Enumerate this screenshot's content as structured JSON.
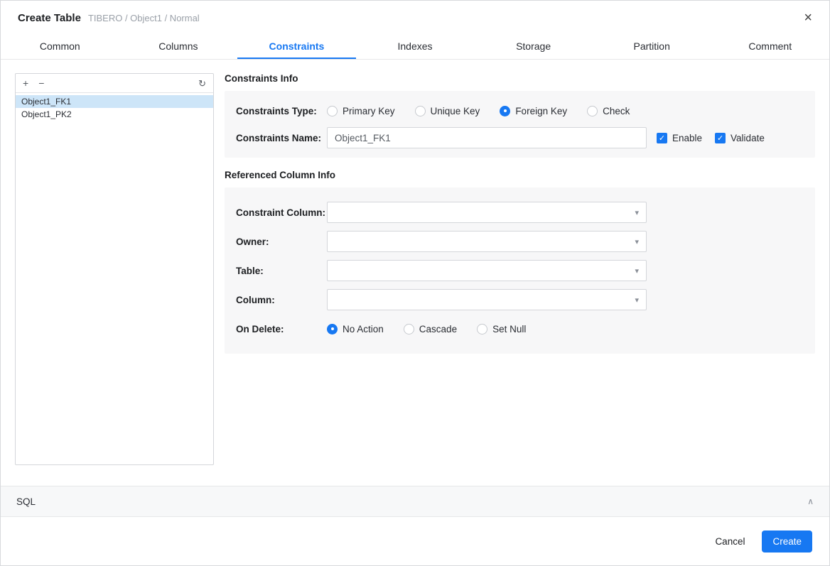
{
  "dialog": {
    "title": "Create Table",
    "subtitle": "TIBERO / Object1 / Normal"
  },
  "icons": {
    "close": "×",
    "add": "+",
    "remove": "−",
    "refresh": "↻",
    "caret_down": "▾",
    "chevron_up": "∧",
    "check": "✓"
  },
  "tabs": [
    {
      "label": "Common",
      "active": false
    },
    {
      "label": "Columns",
      "active": false
    },
    {
      "label": "Constraints",
      "active": true
    },
    {
      "label": "Indexes",
      "active": false
    },
    {
      "label": "Storage",
      "active": false
    },
    {
      "label": "Partition",
      "active": false
    },
    {
      "label": "Comment",
      "active": false
    }
  ],
  "constraint_list": {
    "items": [
      {
        "name": "Object1_FK1",
        "selected": true
      },
      {
        "name": "Object1_PK2",
        "selected": false
      }
    ]
  },
  "constraints_info": {
    "heading": "Constraints Info",
    "type_label": "Constraints Type:",
    "type_options": [
      {
        "label": "Primary Key",
        "checked": false
      },
      {
        "label": "Unique Key",
        "checked": false
      },
      {
        "label": "Foreign Key",
        "checked": true
      },
      {
        "label": "Check",
        "checked": false
      }
    ],
    "name_label": "Constraints Name:",
    "name_value": "Object1_FK1",
    "enable_label": "Enable",
    "enable_checked": true,
    "validate_label": "Validate",
    "validate_checked": true
  },
  "referenced_column_info": {
    "heading": "Referenced Column Info",
    "fields": [
      {
        "label": "Constraint Column:",
        "value": ""
      },
      {
        "label": "Owner:",
        "value": ""
      },
      {
        "label": "Table:",
        "value": ""
      },
      {
        "label": "Column:",
        "value": ""
      }
    ],
    "on_delete_label": "On Delete:",
    "on_delete_options": [
      {
        "label": "No Action",
        "checked": true
      },
      {
        "label": "Cascade",
        "checked": false
      },
      {
        "label": "Set Null",
        "checked": false
      }
    ]
  },
  "sql_section": {
    "label": "SQL"
  },
  "footer": {
    "cancel_label": "Cancel",
    "create_label": "Create"
  },
  "colors": {
    "accent": "#1778f2",
    "selected_item_bg": "#cde5f8",
    "panel_bg": "#f7f7f8"
  }
}
